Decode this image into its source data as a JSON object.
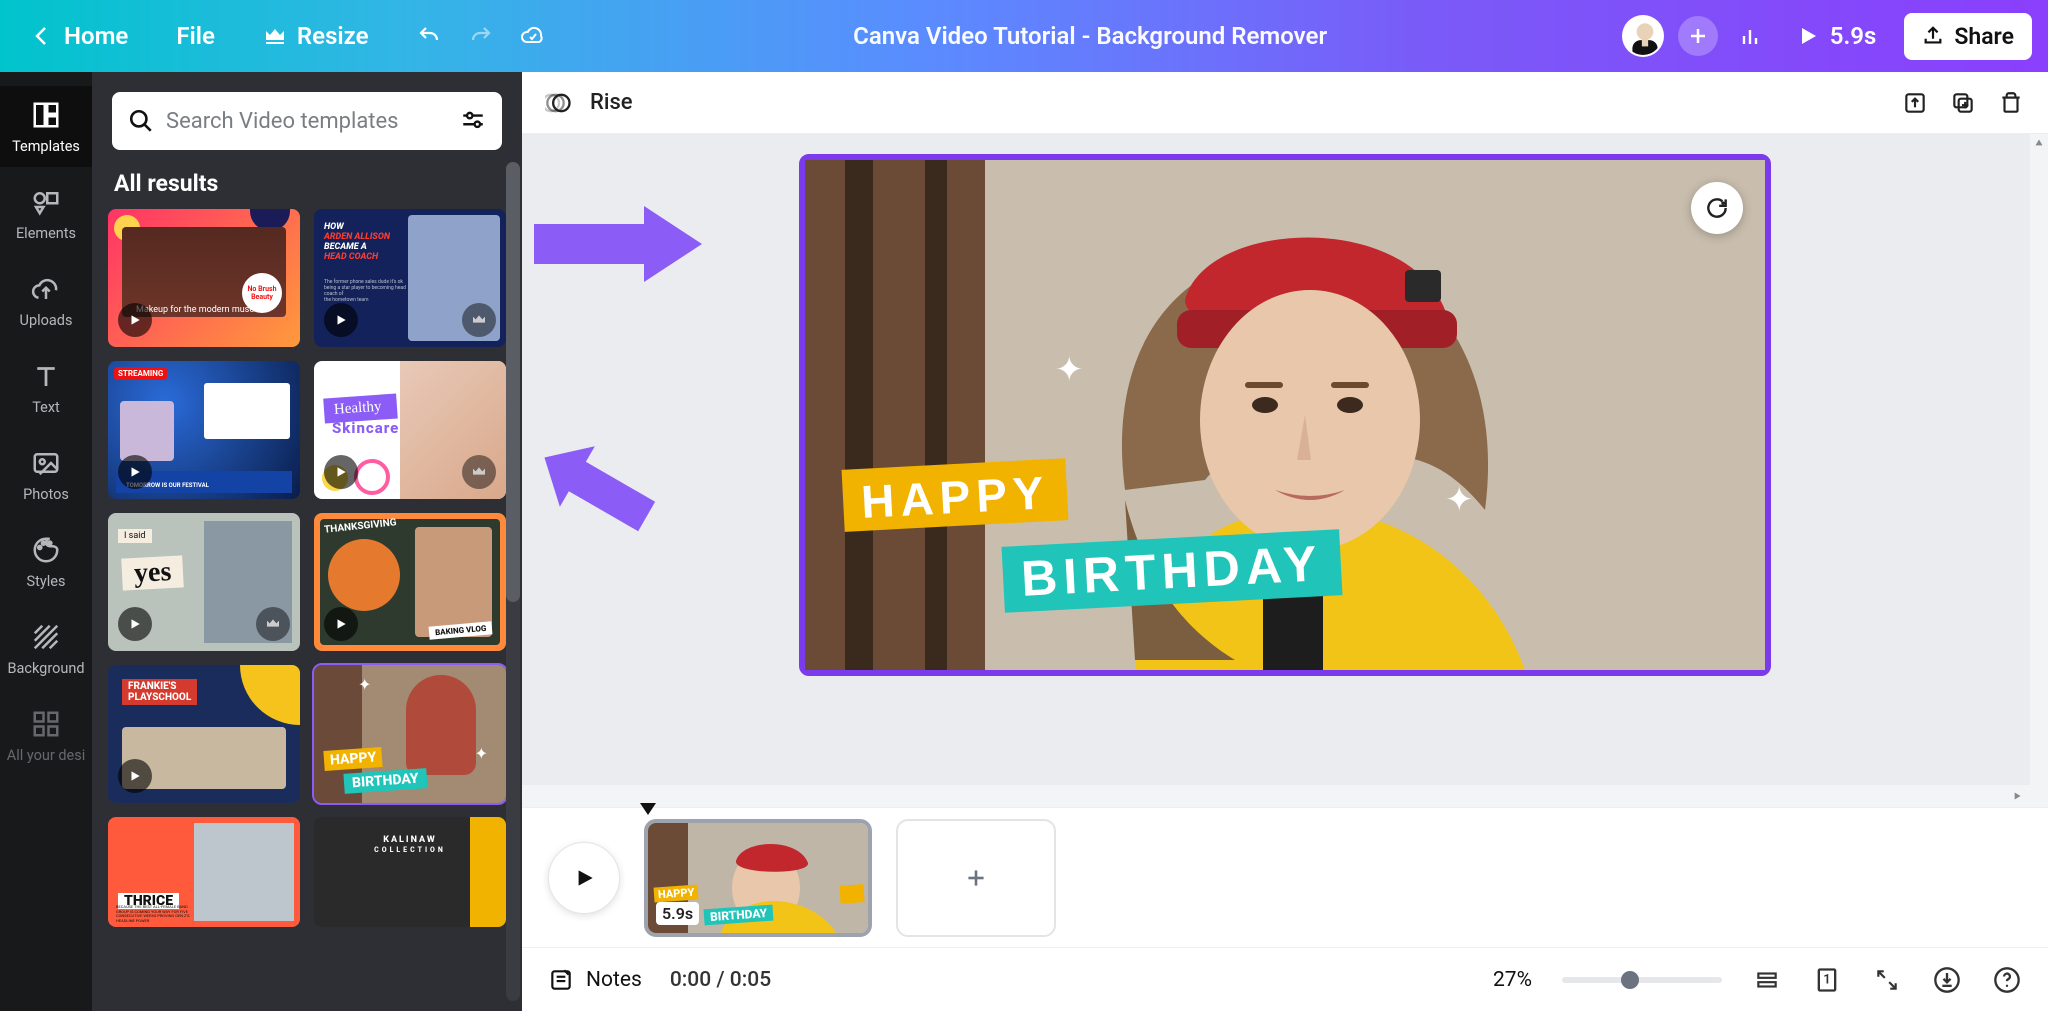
{
  "header": {
    "home": "Home",
    "file": "File",
    "resize": "Resize",
    "doc_title": "Canva Video Tutorial - Background Remover",
    "share": "Share",
    "duration": "5.9s"
  },
  "leftnav": {
    "items": [
      {
        "label": "Templates",
        "icon": "templates",
        "active": true
      },
      {
        "label": "Elements",
        "icon": "elements",
        "active": false
      },
      {
        "label": "Uploads",
        "icon": "uploads",
        "active": false
      },
      {
        "label": "Text",
        "icon": "text",
        "active": false
      },
      {
        "label": "Photos",
        "icon": "photos",
        "active": false
      },
      {
        "label": "Styles",
        "icon": "styles",
        "active": false
      },
      {
        "label": "Background",
        "icon": "background",
        "active": false
      },
      {
        "label": "All your desi",
        "icon": "all",
        "active": false
      }
    ]
  },
  "panel": {
    "search_placeholder": "Search Video templates",
    "heading": "All results",
    "templates": [
      {
        "id": "t1",
        "premium": false,
        "caption": "Makeup for the modern muse",
        "badge": "No Brush Beauty"
      },
      {
        "id": "t2",
        "premium": true,
        "title": "HOW ARDEN ALLISON BECAME A HEAD COACH"
      },
      {
        "id": "t3",
        "premium": false,
        "caption": "STREAMING",
        "sub": "TOMORROW IS OUR FESTIVAL"
      },
      {
        "id": "t4",
        "premium": true,
        "title": "Healthy Skincare"
      },
      {
        "id": "t5",
        "premium": true,
        "caption": "I said",
        "title": "yes"
      },
      {
        "id": "t6",
        "premium": false,
        "title": "THANKSGIVING",
        "sub": "BAKING VLOG"
      },
      {
        "id": "t7",
        "premium": false,
        "title": "FRANKIE'S PLAYSCHOOL"
      },
      {
        "id": "t8",
        "premium": false,
        "title": "HAPPY",
        "sub": "BIRTHDAY",
        "selected": true
      },
      {
        "id": "t9",
        "premium": false,
        "title": "THRICE"
      },
      {
        "id": "t10",
        "premium": false,
        "title": "KALINAW COLLECTION"
      }
    ]
  },
  "canvas_toolbar": {
    "animation_label": "Rise"
  },
  "canvas": {
    "happy": "HAPPY",
    "birthday": "BIRTHDAY"
  },
  "timeline": {
    "clip_duration": "5.9s",
    "clip_happy": "HAPPY",
    "clip_birthday": "BIRTHDAY"
  },
  "bottombar": {
    "notes": "Notes",
    "time": "0:00 / 0:05",
    "zoom": "27%",
    "page_badge": "1"
  },
  "colors": {
    "accent": "#7c3aed",
    "teal": "#20c4b8",
    "yellow": "#f1b300"
  }
}
